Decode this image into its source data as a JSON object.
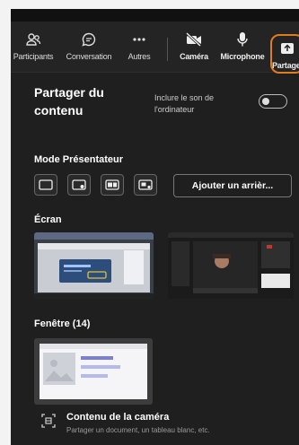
{
  "toolbar": {
    "items": [
      {
        "label": "Participants",
        "icon": "participants-icon"
      },
      {
        "label": "Conversation",
        "icon": "chat-icon"
      },
      {
        "label": "Autres",
        "icon": "more-icon"
      },
      {
        "label": "Caméra",
        "icon": "camera-off-icon"
      },
      {
        "label": "Microphone",
        "icon": "microphone-icon"
      },
      {
        "label": "Partager",
        "icon": "share-icon"
      }
    ],
    "highlight_color": "#e07b1e"
  },
  "panel": {
    "title": "Partager du contenu",
    "include_sound_label": "Inclure le son de l'ordinateur",
    "include_sound_on": false,
    "presenter_mode_heading": "Mode Présentateur",
    "add_background_label": "Ajouter un arrièr...",
    "screen_heading": "Écran",
    "window_heading": "Fenêtre (14)",
    "camera_content_title": "Contenu de la caméra",
    "camera_content_subtitle": "Partager un document, un tableau blanc, etc."
  }
}
